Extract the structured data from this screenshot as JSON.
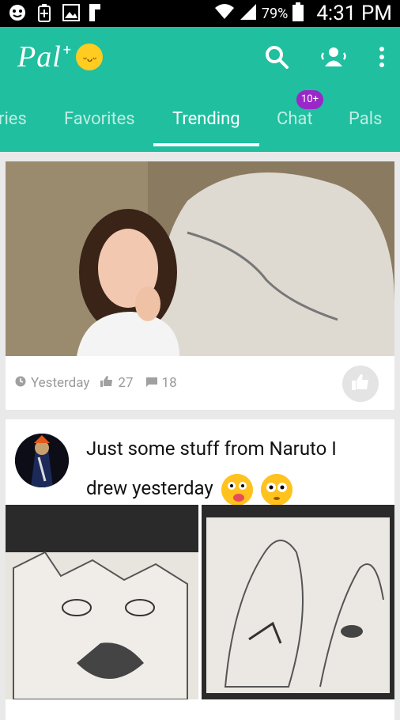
{
  "status_bar": {
    "battery": "79%",
    "time": "4:31 PM",
    "icons": [
      "face-icon",
      "battery-saver-icon",
      "image-icon",
      "flipboard-icon",
      "wifi-icon",
      "signal-icon",
      "battery-icon"
    ]
  },
  "app": {
    "brand": "Pal",
    "brand_plus": "+",
    "accent": "#1fbf9f",
    "badge_color": "#9a28c8"
  },
  "toolbar": {
    "icons": [
      "search-icon",
      "people-icon",
      "more-vert-icon"
    ]
  },
  "tabs": [
    {
      "label": "ries"
    },
    {
      "label": "Favorites"
    },
    {
      "label": "Trending"
    },
    {
      "label": "Chat"
    },
    {
      "label": "Pals"
    }
  ],
  "chat_badge": "10+",
  "posts": [
    {
      "time": "Yesterday",
      "likes": "27",
      "comments": "18"
    },
    {
      "title": "Just some stuff from Naruto I drew yesterday"
    }
  ]
}
